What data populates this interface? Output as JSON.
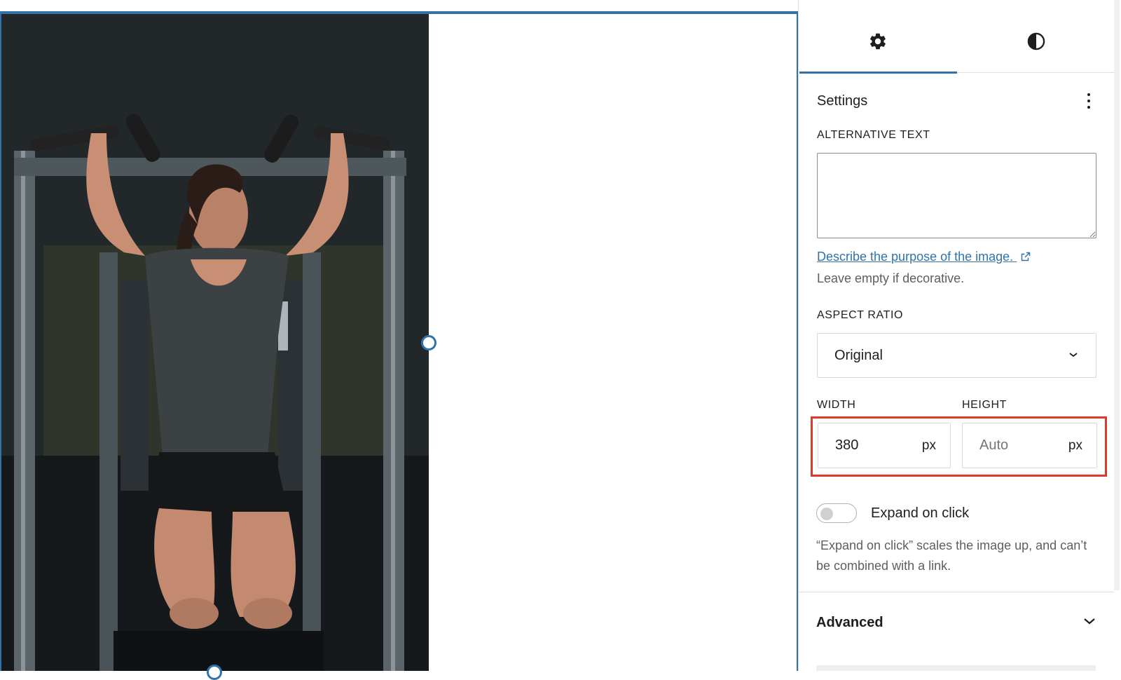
{
  "canvas": {
    "image_alt": "Woman doing hanging knee raises on a pull-up bar in a gym"
  },
  "sidebar": {
    "tabs": [
      {
        "name": "Settings",
        "icon": "gear-icon",
        "active": true
      },
      {
        "name": "Styles",
        "icon": "contrast-icon",
        "active": false
      }
    ],
    "panel_title": "Settings",
    "alt_text_label": "ALTERNATIVE TEXT",
    "alt_text_value": "",
    "describe_link": "Describe the purpose of the image.",
    "describe_help": "Leave empty if decorative.",
    "aspect_ratio_label": "ASPECT RATIO",
    "aspect_ratio_value": "Original",
    "width_label": "WIDTH",
    "height_label": "HEIGHT",
    "width_value": "380",
    "width_unit": "px",
    "height_placeholder": "Auto",
    "height_unit": "px",
    "expand_label": "Expand on click",
    "expand_enabled": false,
    "expand_help": "“Expand on click” scales the image up, and can’t be combined with a link.",
    "advanced_label": "Advanced"
  },
  "colors": {
    "accent": "#3173a8",
    "highlight": "#e0382b"
  }
}
